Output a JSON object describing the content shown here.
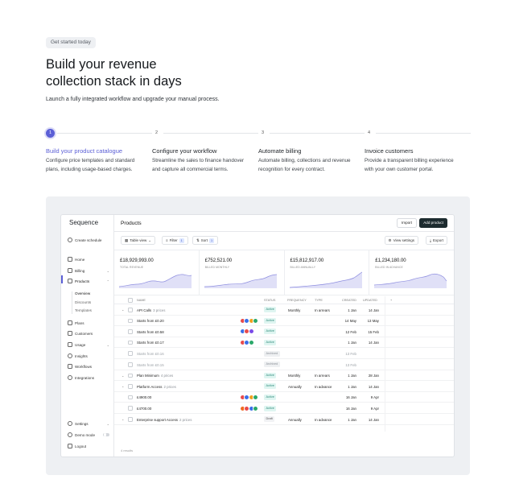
{
  "intro": {
    "pill": "Get started today",
    "title_line1": "Build your revenue",
    "title_line2": "collection stack in days",
    "subtitle": "Launch a fully integrated workflow and upgrade your manual process."
  },
  "steps": [
    {
      "num": "1",
      "title": "Build your product catalogue",
      "desc": "Configure price templates and standard plans, including usage-based charges."
    },
    {
      "num": "2",
      "title": "Configure your workflow",
      "desc": "Streamline the sales to finance handover and capture all commercial terms."
    },
    {
      "num": "3",
      "title": "Automate billing",
      "desc": "Automate billing, collections and revenue recognition for every contract."
    },
    {
      "num": "4",
      "title": "Invoice customers",
      "desc": "Provide a transparent billing experience with your own customer portal."
    }
  ],
  "app": {
    "logo": "Sequence",
    "create_schedule": "Create schedule",
    "nav": {
      "home": "Home",
      "billing": "Billing",
      "products": "Products",
      "overview": "Overview",
      "discounts": "Discounts",
      "templates": "Templates",
      "plans": "Plans",
      "customers": "Customers",
      "usage": "Usage",
      "insights": "Insights",
      "workflows": "Workflows",
      "integrations": "Integrations",
      "settings": "Settings",
      "demo_mode": "Demo mode",
      "logout": "Logout"
    },
    "page_title": "Products",
    "import_label": "Import",
    "add_product_label": "Add product",
    "toolbar": {
      "table_view": "Table view",
      "filter": "Filter",
      "filter_count": "1",
      "sort": "Sort",
      "sort_count": "1",
      "view_settings": "View settings",
      "export": "Export"
    },
    "cards": [
      {
        "value": "£18,929,993.00",
        "label": "TOTAL REVENUE"
      },
      {
        "value": "£752,521.00",
        "label": "BILLED MONTHLY"
      },
      {
        "value": "£15,812,917.00",
        "label": "BILLED ANNUALLY"
      },
      {
        "value": "£1,234,180.00",
        "label": "BILLED IN ADVANCE"
      }
    ],
    "columns": {
      "name": "NAME",
      "status": "STATUS",
      "frequency": "FREQUENCY",
      "type": "TYPE",
      "created": "CREATED",
      "updated": "UPDATED",
      "add": "+"
    },
    "rows": [
      {
        "name": "API Calls",
        "prices": "3 prices",
        "status": "Active",
        "frequency": "Monthly",
        "type": "In arrears",
        "created": "1 Jan",
        "updated": "14 Jan"
      },
      {
        "name": "Starts from £0.20",
        "status": "Active",
        "created": "14 May",
        "updated": "13 May"
      },
      {
        "name": "Starts from £0.58",
        "status": "Active",
        "created": "12 Feb",
        "updated": "15 Feb"
      },
      {
        "name": "Starts from £0.17",
        "status": "Active",
        "created": "1 Jan",
        "updated": "14 Jan"
      },
      {
        "name": "Starts from £0.16",
        "status": "Archived",
        "created": "13 Feb",
        "updated": ""
      },
      {
        "name": "Starts from £0.15",
        "status": "Archived",
        "created": "13 Feb",
        "updated": ""
      },
      {
        "name": "Plan Minimum",
        "prices": "4 prices",
        "status": "Active",
        "frequency": "Monthly",
        "type": "In arrears",
        "created": "1 Jan",
        "updated": "28 Jan"
      },
      {
        "name": "Platform Access",
        "prices": "2 prices",
        "status": "Active",
        "frequency": "Annually",
        "type": "In advance",
        "created": "1 Jan",
        "updated": "14 Jan"
      },
      {
        "name": "£4900.00",
        "status": "Active",
        "created": "16 Jan",
        "updated": "9 Apr"
      },
      {
        "name": "£4700.00",
        "status": "Active",
        "created": "16 Jan",
        "updated": "9 Apr"
      },
      {
        "name": "Enterprise support Access",
        "prices": "2 prices",
        "status": "Draft",
        "frequency": "Annually",
        "type": "In advance",
        "created": "1 Jan",
        "updated": "14 Jan"
      }
    ],
    "footer": "4 results"
  },
  "colors": {
    "accent": "#5b5fd6",
    "chart_fill": "#d9d9f5",
    "chart_line": "#8f8fe0",
    "dark_button": "#1d2b2f"
  }
}
